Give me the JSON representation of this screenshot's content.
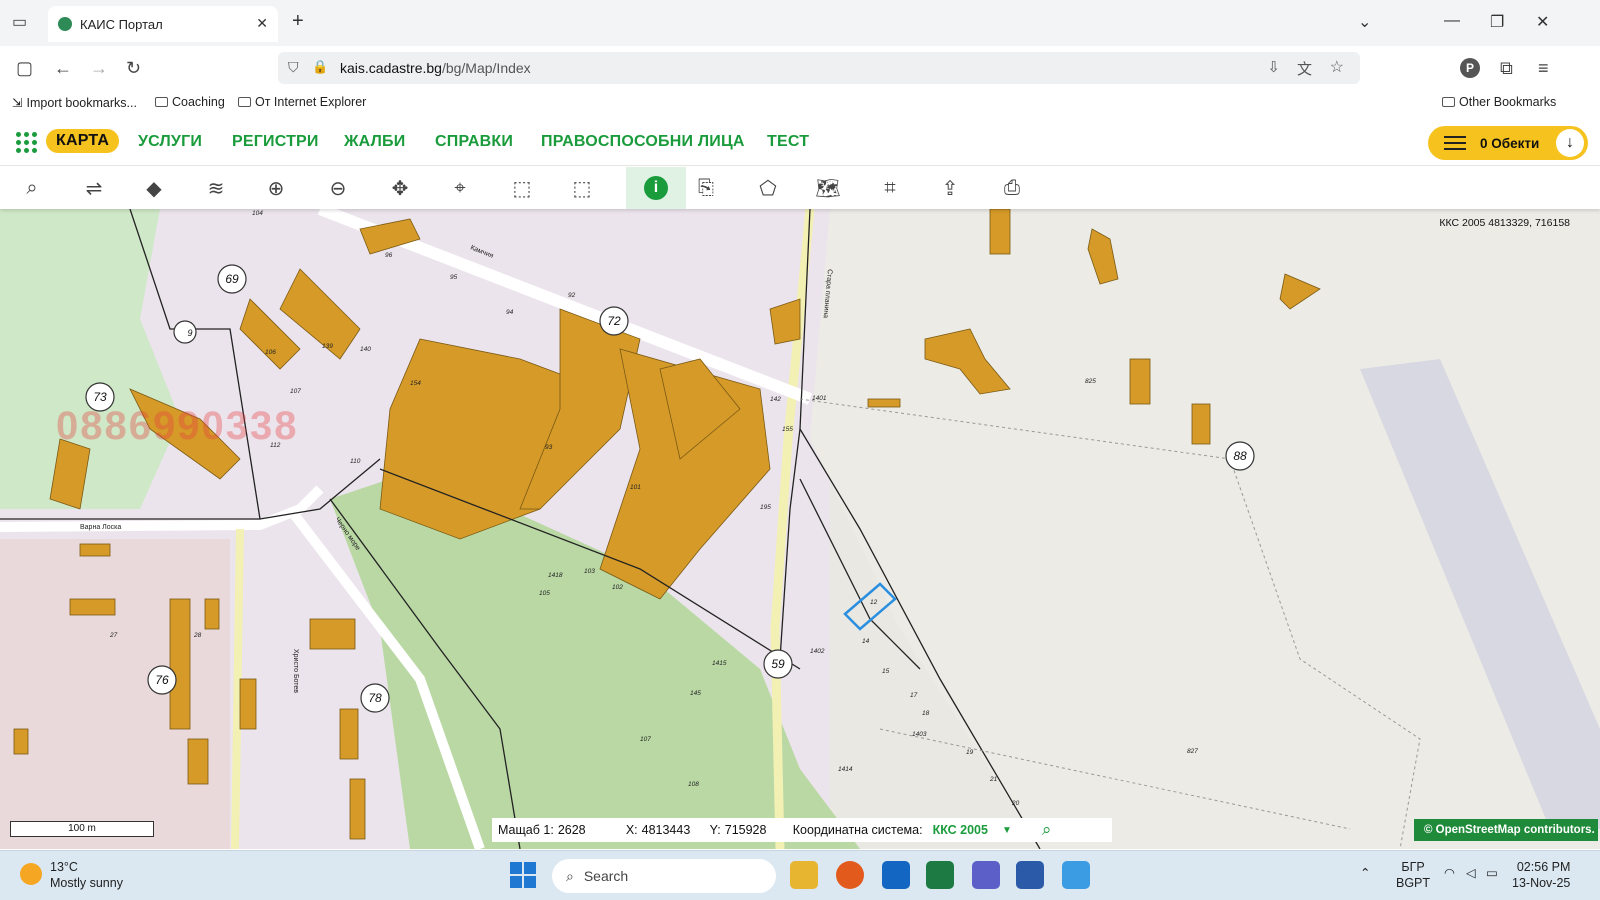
{
  "browser": {
    "tab_title": "КАИС Портал",
    "url_host": "kais.cadastre.bg",
    "url_path": "/bg/Map/Index",
    "bookmarks": [
      {
        "label": "Import bookmarks..."
      },
      {
        "label": "Coaching"
      },
      {
        "label": "От Internet Explorer"
      }
    ],
    "other_bookmarks": "Other Bookmarks",
    "profile_letter": "P"
  },
  "appnav": {
    "items": [
      {
        "label": "КАРТА"
      },
      {
        "label": "УСЛУГИ"
      },
      {
        "label": "РЕГИСТРИ"
      },
      {
        "label": "ЖАЛБИ"
      },
      {
        "label": "СПРАВКИ"
      },
      {
        "label": "ПРАВОСПОСОБНИ ЛИЦА"
      },
      {
        "label": "ТЕСТ"
      }
    ],
    "objects_label": "0 Обекти",
    "accent_color": "#1a9c3c",
    "highlight_color": "#f6c21d"
  },
  "toolbar": {
    "tools": [
      "search-icon",
      "route-icon",
      "layer-single-icon",
      "layers-icon",
      "zoom-in-icon",
      "zoom-out-icon",
      "pan-icon",
      "pin-icon",
      "select-add-icon",
      "select-remove-icon",
      "info-icon",
      "export-icon",
      "polygon-icon",
      "map-icon",
      "grid-icon",
      "upload-icon",
      "print-icon"
    ],
    "info_glyph": "i"
  },
  "map": {
    "coord_readout": "ККС 2005 4813329, 716158",
    "scale_label": "100 m",
    "watermark": "0886990338",
    "circle_labels": [
      "69",
      "72",
      "73",
      "88",
      "76",
      "78",
      "59",
      "9"
    ],
    "street_labels": [
      "Варна Лоска",
      "Камчия",
      "Черно море",
      "Христо Ботев",
      "Стара планина"
    ],
    "parcel_labels": [
      "104",
      "96",
      "95",
      "94",
      "92",
      "101",
      "93",
      "154",
      "106",
      "107",
      "139",
      "140",
      "112",
      "110",
      "142",
      "155",
      "195",
      "102",
      "103",
      "105",
      "145",
      "107",
      "108",
      "1403",
      "1414",
      "1402",
      "1401",
      "1415",
      "1418",
      "27",
      "28",
      "825",
      "827",
      "12",
      "14",
      "15",
      "17",
      "18",
      "19",
      "21",
      "20"
    ]
  },
  "status": {
    "scale_label": "Мащаб 1:",
    "scale_value": "2628",
    "x_label": "X:",
    "x_value": "4813443",
    "y_label": "Y:",
    "y_value": "715928",
    "crs_label": "Координатна система:",
    "crs_value": "ККС 2005"
  },
  "attribution": "© OpenStreetMap contributors.",
  "taskbar": {
    "temperature": "13°C",
    "weather": "Mostly sunny",
    "search_placeholder": "Search",
    "lang1": "БГР",
    "lang2": "BGPT",
    "time": "02:56 PM",
    "date": "13-Nov-25"
  }
}
